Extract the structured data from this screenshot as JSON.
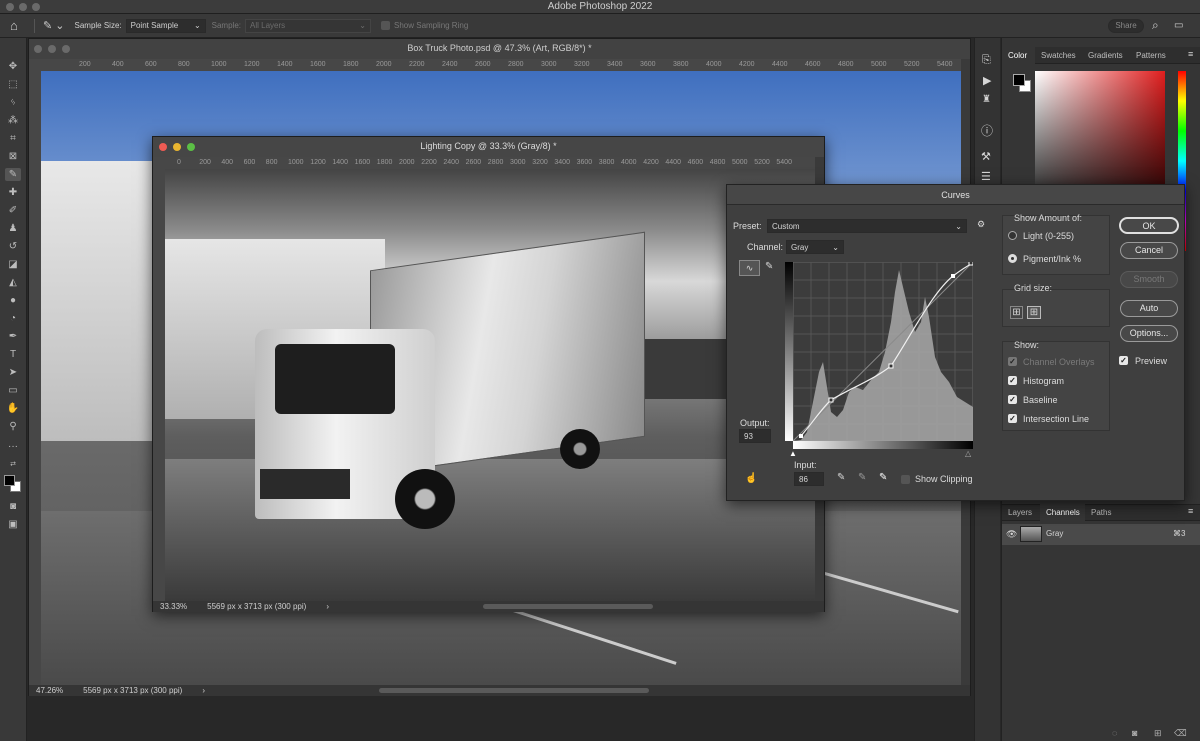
{
  "app": {
    "title": "Adobe Photoshop 2022"
  },
  "options": {
    "sample_size_label": "Sample Size:",
    "sample_size_value": "Point Sample",
    "sample_label": "Sample:",
    "sample_value": "All Layers",
    "sampling_ring_label": "Show Sampling Ring",
    "share_label": "Share"
  },
  "main_doc": {
    "title": "Box Truck Photo.psd @ 47.3% (Art, RGB/8*) *",
    "zoom": "47.26%",
    "info": "5569 px x 3713 px (300 ppi)",
    "ruler": [
      "200",
      "400",
      "600",
      "800",
      "1000",
      "1200",
      "1400",
      "1600",
      "1800",
      "2000",
      "2200",
      "2400",
      "2600",
      "2800",
      "3000",
      "3200",
      "3400",
      "3600",
      "3800",
      "4000",
      "4200",
      "4400",
      "4600",
      "4800",
      "5000",
      "5200",
      "5400"
    ]
  },
  "sub_doc": {
    "title": "Lighting Copy @ 33.3% (Gray/8) *",
    "zoom": "33.33%",
    "info": "5569 px x 3713 px (300 ppi)",
    "ruler": [
      "0",
      "200",
      "400",
      "600",
      "800",
      "1000",
      "1200",
      "1400",
      "1600",
      "1800",
      "2000",
      "2200",
      "2400",
      "2600",
      "2800",
      "3000",
      "3200",
      "3400",
      "3600",
      "3800",
      "4000",
      "4200",
      "4400",
      "4600",
      "4800",
      "5000",
      "5200",
      "5400"
    ]
  },
  "curves": {
    "title": "Curves",
    "preset_label": "Preset:",
    "preset_value": "Custom",
    "channel_label": "Channel:",
    "channel_value": "Gray",
    "output_label": "Output:",
    "output_value": "93",
    "input_label": "Input:",
    "input_value": "86",
    "show_clipping": "Show Clipping",
    "show_amount_label": "Show Amount of:",
    "light_label": "Light  (0-255)",
    "pigment_label": "Pigment/Ink %",
    "grid_size_label": "Grid size:",
    "show_label": "Show:",
    "channel_overlays": "Channel Overlays",
    "histogram": "Histogram",
    "baseline": "Baseline",
    "intersection_line": "Intersection Line",
    "ok": "OK",
    "cancel": "Cancel",
    "smooth": "Smooth",
    "auto": "Auto",
    "options": "Options...",
    "preview": "Preview"
  },
  "right_panel": {
    "tabs": [
      "Color",
      "Swatches",
      "Gradients",
      "Patterns"
    ],
    "bottom_tabs": [
      "Layers",
      "Channels",
      "Paths"
    ],
    "channel_name": "Gray",
    "channel_shortcut": "⌘3"
  }
}
